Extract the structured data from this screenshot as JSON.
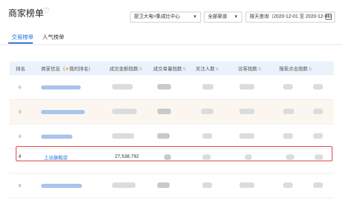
{
  "header": {
    "title": "商家榜单",
    "heart_icon": "heart-outline-icon",
    "category_select": "厨卫大电>集成灶中心",
    "channel_select": "全部渠道",
    "date_range": "按天查询（2020-12-01 至 2020-12-01）"
  },
  "tabs": [
    {
      "label": "交易榜单",
      "active": true
    },
    {
      "label": "人气榜单",
      "active": false
    }
  ],
  "table": {
    "columns": [
      {
        "label": "排名"
      },
      {
        "label": "商家信息（",
        "star": "★",
        "suffix": "我的排名）"
      },
      {
        "label": "成交金额指数"
      },
      {
        "label": "成交单量指数"
      },
      {
        "label": "关注人数"
      },
      {
        "label": "访客指数"
      },
      {
        "label": "搜索点击指数"
      }
    ],
    "visible_row": {
      "rank": "4",
      "merchant": "上派旗舰店",
      "amount_index": "27,538,792"
    }
  },
  "colors": {
    "accent": "#1f6fd8",
    "highlight_border": "#e03a3a",
    "header_bg": "#eaf2fb"
  }
}
